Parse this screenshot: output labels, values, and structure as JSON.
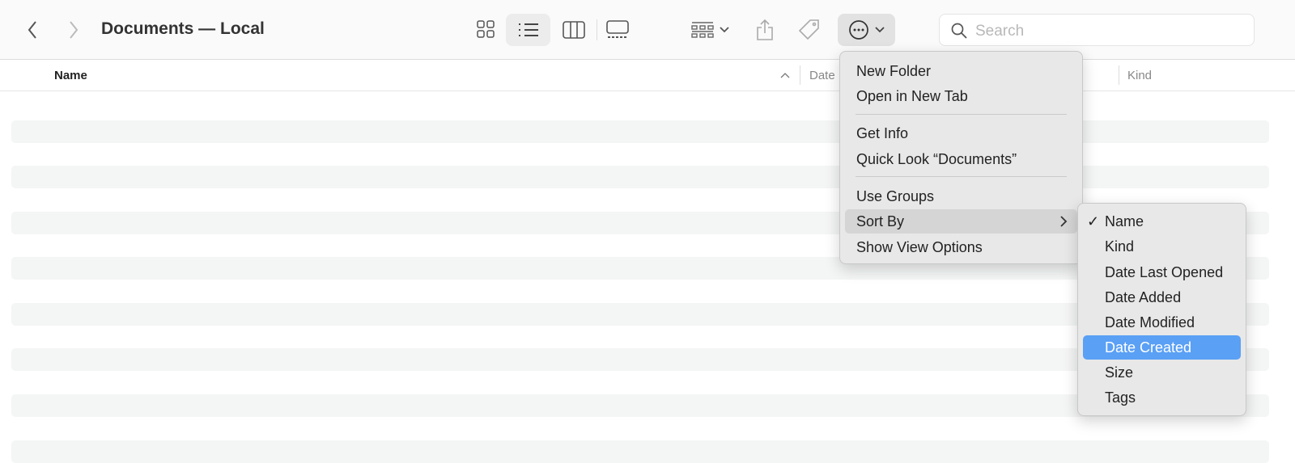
{
  "window": {
    "title": "Documents — Local"
  },
  "search": {
    "placeholder": "Search"
  },
  "columns": {
    "name": "Name",
    "date": "Date",
    "kind": "Kind"
  },
  "menu": {
    "items": [
      "New Folder",
      "Open in New Tab",
      "Get Info",
      "Quick Look “Documents”",
      "Use Groups",
      "Sort By",
      "Show View Options"
    ]
  },
  "sort_menu": {
    "items": [
      "Name",
      "Kind",
      "Date Last Opened",
      "Date Added",
      "Date Modified",
      "Date Created",
      "Size",
      "Tags"
    ],
    "checked": "Name",
    "highlighted": "Date Created",
    "check": "✓"
  },
  "colors": {
    "highlight": "#5aa0f5"
  }
}
